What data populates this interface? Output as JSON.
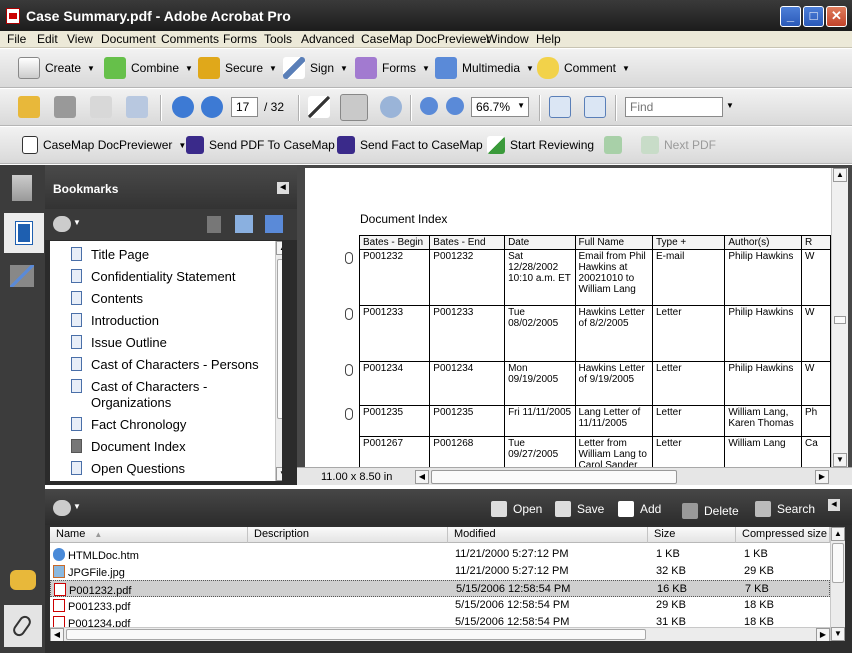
{
  "window": {
    "title": "Case Summary.pdf - Adobe Acrobat Pro",
    "min": "_",
    "max": "□",
    "close": "✕"
  },
  "menu": [
    "File",
    "Edit",
    "View",
    "Document",
    "Comments",
    "Forms",
    "Tools",
    "Advanced",
    "CaseMap DocPreviewer",
    "Window",
    "Help"
  ],
  "toolbar1": {
    "create": "Create",
    "combine": "Combine",
    "secure": "Secure",
    "sign": "Sign",
    "forms": "Forms",
    "multimedia": "Multimedia",
    "comment": "Comment"
  },
  "toolbar2": {
    "page_current": "17",
    "page_total": "/ 32",
    "zoom": "66.7%",
    "find_placeholder": "Find"
  },
  "toolbar3": {
    "casemap": "CaseMap DocPreviewer",
    "send_pdf": "Send PDF To CaseMap",
    "send_fact": "Send Fact to CaseMap",
    "start_review": "Start Reviewing",
    "next_pdf": "Next PDF"
  },
  "bookmarks": {
    "title": "Bookmarks",
    "items": [
      {
        "label": "Title Page"
      },
      {
        "label": "Confidentiality Statement"
      },
      {
        "label": "Contents"
      },
      {
        "label": "Introduction"
      },
      {
        "label": "Issue Outline"
      },
      {
        "label": "Cast of Characters - Persons"
      },
      {
        "label": "Cast of Characters - Organizations"
      },
      {
        "label": "Fact Chronology"
      },
      {
        "label": "Document Index"
      },
      {
        "label": "Open Questions"
      }
    ]
  },
  "document": {
    "heading": "Document Index",
    "columns": [
      "Bates - Begin",
      "Bates - End",
      "Date",
      "Full Name",
      "Type +",
      "Author(s)",
      "R"
    ],
    "rows": [
      [
        "P001232",
        "P001232",
        "Sat 12/28/2002 10:10 a.m. ET",
        "Email from Phil Hawkins at 20021010 to William Lang",
        "E-mail",
        "Philip Hawkins",
        "W"
      ],
      [
        "P001233",
        "P001233",
        "Tue 08/02/2005",
        "Hawkins Letter of 8/2/2005",
        "Letter",
        "Philip Hawkins",
        "W"
      ],
      [
        "P001234",
        "P001234",
        "Mon 09/19/2005",
        "Hawkins Letter of 9/19/2005",
        "Letter",
        "Philip Hawkins",
        "W"
      ],
      [
        "P001235",
        "P001235",
        "Fri 11/11/2005",
        "Lang Letter of 11/11/2005",
        "Letter",
        "William Lang, Karen Thomas",
        "Ph"
      ],
      [
        "P001267",
        "P001268",
        "Tue 09/27/2005",
        "Letter from William Lang to Carol Sander",
        "Letter",
        "William Lang",
        "Ca"
      ]
    ],
    "page_size": "11.00 x 8.50 in"
  },
  "attachments": {
    "actions": {
      "open": "Open",
      "save": "Save",
      "add": "Add",
      "delete": "Delete",
      "search": "Search"
    },
    "columns": [
      "Name",
      "Description",
      "Modified",
      "Size",
      "Compressed size"
    ],
    "files": [
      {
        "name": "HTMLDoc.htm",
        "description": "",
        "modified": "11/21/2000 5:27:12 PM",
        "size": "1 KB",
        "compressed": "1 KB",
        "icon": "html-file-icon"
      },
      {
        "name": "JPGFile.jpg",
        "description": "",
        "modified": "11/21/2000 5:27:12 PM",
        "size": "32 KB",
        "compressed": "29 KB",
        "icon": "image-file-icon"
      },
      {
        "name": "P001232.pdf",
        "description": "",
        "modified": "5/15/2006 12:58:54 PM",
        "size": "16 KB",
        "compressed": "7 KB",
        "icon": "pdf-file-icon"
      },
      {
        "name": "P001233.pdf",
        "description": "",
        "modified": "5/15/2006 12:58:54 PM",
        "size": "29 KB",
        "compressed": "18 KB",
        "icon": "pdf-file-icon"
      },
      {
        "name": "P001234.pdf",
        "description": "",
        "modified": "5/15/2006 12:58:54 PM",
        "size": "31 KB",
        "compressed": "18 KB",
        "icon": "pdf-file-icon"
      }
    ],
    "selected_index": 2
  }
}
